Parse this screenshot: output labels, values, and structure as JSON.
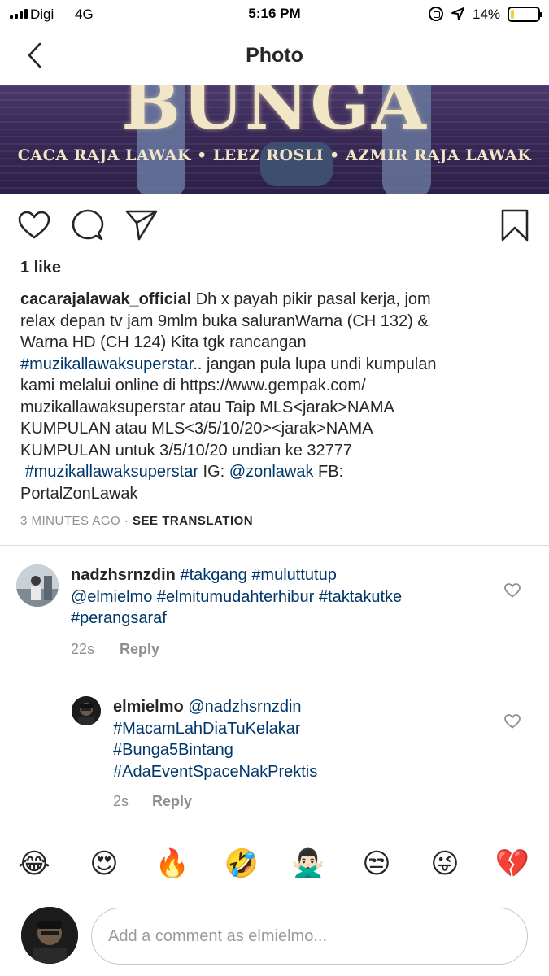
{
  "status_bar": {
    "carrier": "Digi",
    "network": "4G",
    "time": "5:16 PM",
    "battery_percent": "14%",
    "battery_level": 0.14
  },
  "header": {
    "title": "Photo"
  },
  "post_image": {
    "title": "BUNGA",
    "credits": "CACA RAJA LAWAK • LEEZ ROSLI • AZMIR RAJA LAWAK"
  },
  "post": {
    "likes": "1 like",
    "caption": {
      "username": "cacarajalawak_official",
      "line1": "Dh x payah pikir pasal kerja, jom",
      "line2": "relax depan tv jam 9mlm buka saluranWarna (CH 132) &",
      "line3": "Warna HD (CH 124) Kita tgk rancangan",
      "hashtag1": "#muzikallawaksuperstar",
      "line4_rest": ".. jangan pula lupa undi kumpulan",
      "line5": "kami melalui online di https://www.gempak.com/",
      "line6": "muzikallawaksuperstar atau Taip MLS<jarak>NAMA",
      "line7": "KUMPULAN atau MLS<3/5/10/20><jarak>NAMA",
      "line8": "KUMPULAN untuk 3/5/10/20 undian ke 32777",
      "hashtag2": "#muzikallawaksuperstar",
      "ig_label": "IG:",
      "ig_handle": "@zonlawak",
      "fb_label": "FB:",
      "fb_name": "PortalZonLawak"
    },
    "time_ago": "3 MINUTES AGO",
    "separator": "·",
    "see_translation": "SEE TRANSLATION"
  },
  "comments": [
    {
      "username": "nadzhsrnzdin",
      "tags": [
        "#takgang",
        "#muluttutup",
        "@elmielmo",
        "#elmitumudahterhibur",
        "#taktakutke",
        "#perangsaraf"
      ],
      "time": "22s",
      "reply_label": "Reply"
    },
    {
      "username": "elmielmo",
      "tags": [
        "@nadzhsrnzdin",
        "#MacamLahDiaTuKelakar",
        "#Bunga5Bintang",
        "#AdaEventSpaceNakPrektis"
      ],
      "time": "2s",
      "reply_label": "Reply"
    }
  ],
  "emoji_bar": [
    "😂",
    "😍",
    "🔥",
    "🤣",
    "🙅🏻‍♂️",
    "😒",
    "😜",
    "💔"
  ],
  "comment_input": {
    "placeholder": "Add a comment as elmielmo..."
  }
}
